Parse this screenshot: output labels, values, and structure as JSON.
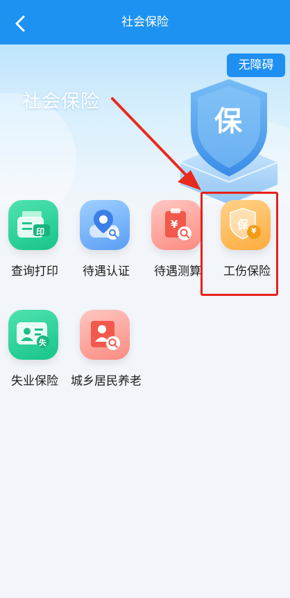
{
  "header": {
    "title": "社会保险"
  },
  "banner": {
    "title": "社会保险",
    "accessibility_label": "无障碍",
    "shield_char": "保"
  },
  "services": [
    {
      "label": "查询打印",
      "icon": "print-icon",
      "icon_text": "印"
    },
    {
      "label": "待遇认证",
      "icon": "location-search-icon"
    },
    {
      "label": "待遇测算",
      "icon": "clipboard-yen-search-icon",
      "icon_text": "¥"
    },
    {
      "label": "工伤保险",
      "icon": "shield-yen-icon",
      "icon_text": "保"
    },
    {
      "label": "失业保险",
      "icon": "id-card-icon",
      "icon_text": "失"
    },
    {
      "label": "城乡居民养老",
      "icon": "elder-search-icon"
    }
  ],
  "colors": {
    "header": "#1d92f0",
    "highlight": "#e8201a",
    "arrow": "#ea2a1f"
  }
}
